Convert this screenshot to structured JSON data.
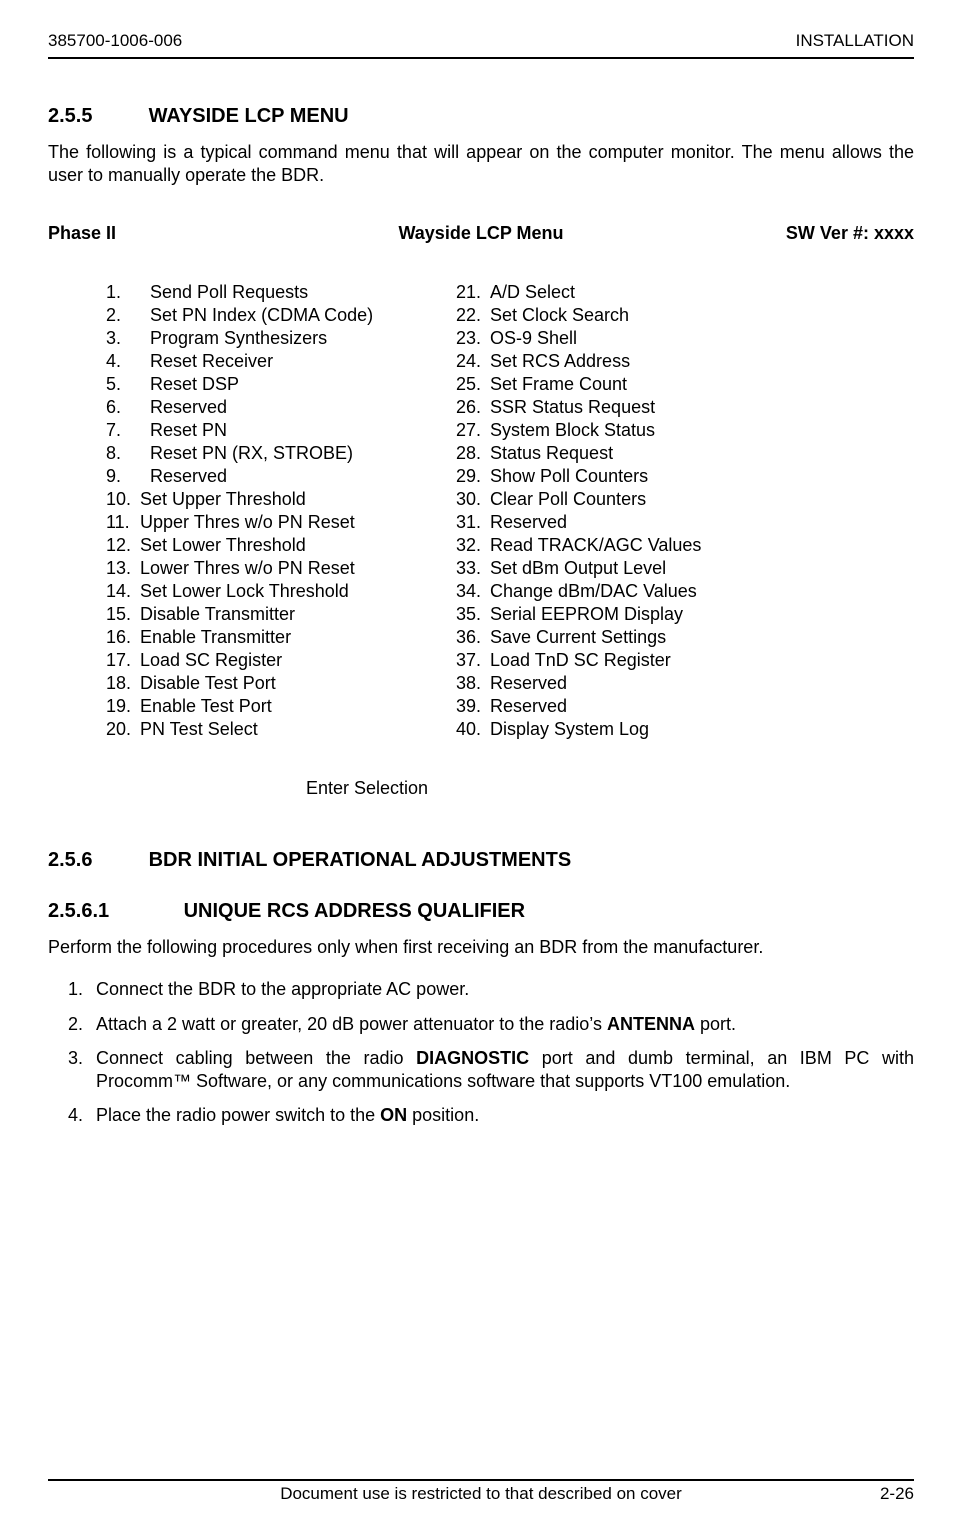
{
  "header": {
    "left": "385700-1006-006",
    "right": "INSTALLATION"
  },
  "sec_2_5_5": {
    "num": "2.5.5",
    "title": "WAYSIDE LCP MENU",
    "para": "The following is a typical command menu that will appear on the computer monitor.  The menu allows the user to manually operate the BDR."
  },
  "phase_row": {
    "left": "Phase II",
    "mid": "Wayside LCP Menu",
    "right": "SW Ver #: xxxx"
  },
  "menu": {
    "left": [
      {
        "num": "1.",
        "pad": true,
        "text": "Send Poll Requests"
      },
      {
        "num": "2.",
        "pad": true,
        "text": "Set PN Index (CDMA Code)"
      },
      {
        "num": "3.",
        "pad": true,
        "text": "Program Synthesizers"
      },
      {
        "num": "4.",
        "pad": true,
        "text": "Reset Receiver"
      },
      {
        "num": "5.",
        "pad": true,
        "text": "Reset DSP"
      },
      {
        "num": "6.",
        "pad": true,
        "text": "Reserved"
      },
      {
        "num": "7.",
        "pad": true,
        "text": "Reset PN"
      },
      {
        "num": "8.",
        "pad": true,
        "text": "Reset PN (RX, STROBE)"
      },
      {
        "num": "9.",
        "pad": true,
        "text": "Reserved"
      },
      {
        "num": "10.",
        "pad": false,
        "text": "Set Upper Threshold"
      },
      {
        "num": "11.",
        "pad": false,
        "text": "Upper Thres w/o PN Reset"
      },
      {
        "num": "12.",
        "pad": false,
        "text": "Set Lower Threshold"
      },
      {
        "num": "13.",
        "pad": false,
        "text": "Lower Thres w/o PN Reset"
      },
      {
        "num": "14.",
        "pad": false,
        "text": "Set Lower Lock Threshold"
      },
      {
        "num": "15.",
        "pad": false,
        "text": "Disable Transmitter"
      },
      {
        "num": "16.",
        "pad": false,
        "text": "Enable Transmitter"
      },
      {
        "num": "17.",
        "pad": false,
        "text": "Load SC Register"
      },
      {
        "num": "18.",
        "pad": false,
        "text": "Disable Test Port"
      },
      {
        "num": "19.",
        "pad": false,
        "text": "Enable Test Port"
      },
      {
        "num": "20.",
        "pad": false,
        "text": "PN Test Select"
      }
    ],
    "right": [
      {
        "num": "21.",
        "text": "A/D Select"
      },
      {
        "num": "22.",
        "text": "Set Clock Search"
      },
      {
        "num": "23.",
        "text": "OS-9 Shell"
      },
      {
        "num": "24.",
        "text": "Set RCS Address"
      },
      {
        "num": "25.",
        "text": "Set Frame Count"
      },
      {
        "num": "26.",
        "text": "SSR Status Request"
      },
      {
        "num": "27.",
        "text": "System Block Status"
      },
      {
        "num": "28.",
        "text": "Status Request"
      },
      {
        "num": "29.",
        "text": "Show Poll Counters"
      },
      {
        "num": "30.",
        "text": "Clear Poll Counters"
      },
      {
        "num": "31.",
        "text": "Reserved"
      },
      {
        "num": "32.",
        "text": "Read TRACK/AGC Values"
      },
      {
        "num": "33.",
        "text": "Set dBm Output Level"
      },
      {
        "num": "34.",
        "text": "Change dBm/DAC Values"
      },
      {
        "num": "35.",
        "text": "Serial EEPROM Display"
      },
      {
        "num": "36.",
        "text": "Save Current Settings"
      },
      {
        "num": "37.",
        "text": "Load TnD SC Register"
      },
      {
        "num": "38.",
        "text": "Reserved"
      },
      {
        "num": "39.",
        "text": "Reserved"
      },
      {
        "num": "40.",
        "text": "Display System Log"
      }
    ]
  },
  "enter_selection": "Enter Selection",
  "sec_2_5_6": {
    "num": "2.5.6",
    "title": "BDR INITIAL OPERATIONAL ADJUSTMENTS"
  },
  "sec_2_5_6_1": {
    "num": "2.5.6.1",
    "title": "UNIQUE RCS ADDRESS QUALIFIER",
    "intro": "Perform the following procedures only when first receiving an BDR from the manufacturer.",
    "steps": {
      "s1": "Connect the BDR to the appropriate AC power.",
      "s2_pre": "Attach a 2 watt or greater, 20 dB power attenuator to the radio’s ",
      "s2_bold": "ANTENNA",
      "s2_post": " port.",
      "s3_pre": "Connect cabling between the radio ",
      "s3_bold": "DIAGNOSTIC",
      "s3_post": " port and dumb terminal, an IBM PC with Procomm™ Software, or any communications software that supports VT100 emulation.",
      "s4_pre": "Place the radio power switch to the ",
      "s4_bold": "ON",
      "s4_post": " position."
    }
  },
  "footer": {
    "center": "Document use is restricted to that described on cover",
    "right": "2-26"
  }
}
